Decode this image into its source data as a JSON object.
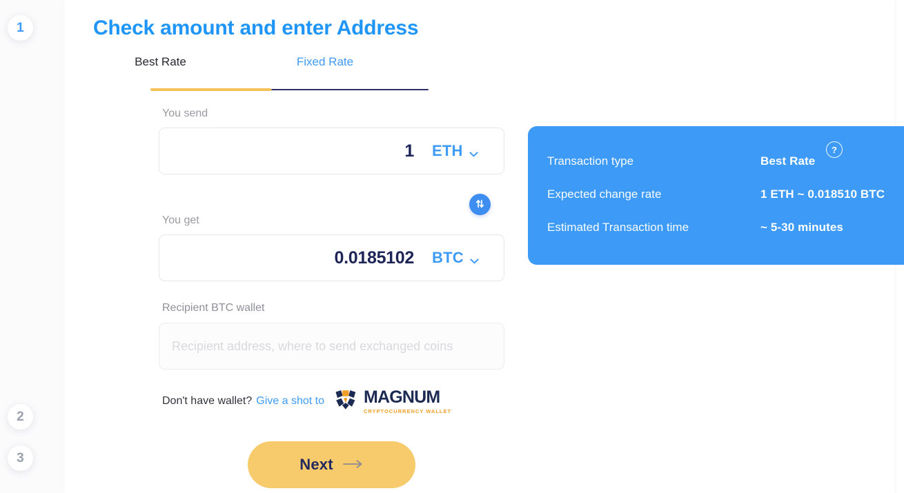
{
  "steps": [
    {
      "number": "1",
      "state": "active"
    },
    {
      "number": "2",
      "state": "inactive"
    },
    {
      "number": "3",
      "state": "inactive"
    }
  ],
  "page": {
    "title": "Check amount and enter Address"
  },
  "tabs": [
    {
      "label": "Best Rate",
      "active": true
    },
    {
      "label": "Fixed Rate",
      "active": false
    }
  ],
  "send": {
    "label": "You send",
    "value": "1",
    "currency": "ETH",
    "chevron_icon": "chevron-down-icon"
  },
  "swap": {
    "icon": "swap-vertical-icon"
  },
  "get": {
    "label": "You get",
    "value": "0.0185102",
    "currency": "BTC",
    "chevron_icon": "chevron-down-icon"
  },
  "recipient": {
    "label": "Recipient BTC wallet",
    "value": "",
    "placeholder": "Recipient address, where to send exchanged coins"
  },
  "promo": {
    "question": "Don't have wallet?",
    "link": "Give a shot to",
    "brand_name": "MAGNUM",
    "brand_tagline": "CRYPTOCURRENCY WALLET"
  },
  "next_button": {
    "label": "Next",
    "arrow_icon": "arrow-right-icon"
  },
  "info_panel": {
    "help_icon": "question-mark-icon",
    "rows": [
      {
        "key": "Transaction type",
        "value": "Best Rate"
      },
      {
        "key": "Expected change rate",
        "value": "1 ETH ~ 0.018510 BTC"
      },
      {
        "key": "Estimated Transaction time",
        "value": "~ 5-30 minutes"
      }
    ]
  },
  "colors": {
    "accent_blue": "#3d9bf7",
    "title_blue": "#1e95f7",
    "accent_yellow": "#f7ca6b",
    "tab_underline": "#f5c159",
    "navy": "#1d2458",
    "magnum_navy": "#1d2a52",
    "magnum_orange": "#f0a029",
    "placeholder_gray": "#d8d9de",
    "label_gray": "#9a9aa2"
  }
}
